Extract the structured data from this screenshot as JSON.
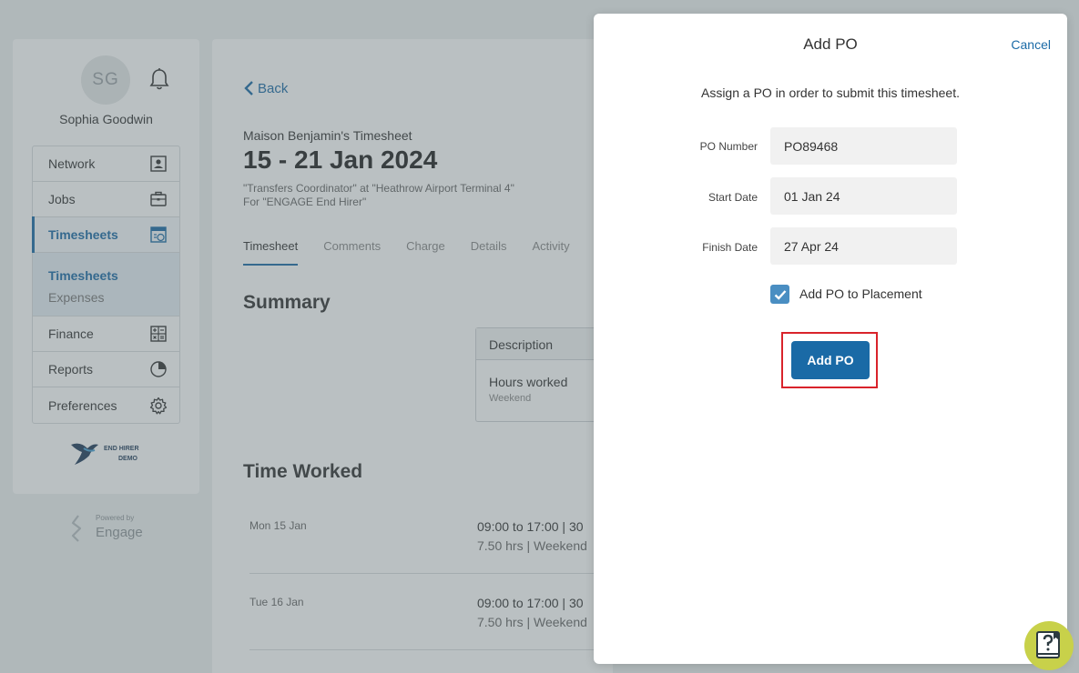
{
  "user": {
    "initials": "SG",
    "name": "Sophia Goodwin"
  },
  "nav": {
    "items": [
      {
        "label": "Network"
      },
      {
        "label": "Jobs"
      },
      {
        "label": "Timesheets"
      },
      {
        "label": "Finance"
      },
      {
        "label": "Reports"
      },
      {
        "label": "Preferences"
      }
    ],
    "sub": [
      {
        "label": "Timesheets"
      },
      {
        "label": "Expenses"
      }
    ]
  },
  "brand": {
    "logo_text_1": "END HIRER",
    "logo_text_2": "DEMO",
    "powered_by": "Powered by",
    "engage": "Engage"
  },
  "page": {
    "back_label": "Back",
    "subtitle": "Maison Benjamin's Timesheet",
    "title": "15 - 21 Jan 2024",
    "meta_line_1": "\"Transfers Coordinator\" at \"Heathrow Airport Terminal 4\"",
    "meta_line_2": "For \"ENGAGE End Hirer\"",
    "tabs": [
      {
        "label": "Timesheet"
      },
      {
        "label": "Comments"
      },
      {
        "label": "Charge"
      },
      {
        "label": "Details"
      },
      {
        "label": "Activity"
      }
    ],
    "summary_heading": "Summary",
    "summary_table": {
      "header": "Description",
      "row_title": "Hours worked",
      "row_sub": "Weekend"
    },
    "time_worked_heading": "Time Worked",
    "time_rows": [
      {
        "date": "Mon 15 Jan",
        "time": "09:00 to 17:00  |  30",
        "hours": "7.50 hrs  |  Weekend"
      },
      {
        "date": "Tue 16 Jan",
        "time": "09:00 to 17:00  |  30",
        "hours": "7.50 hrs  |  Weekend"
      }
    ]
  },
  "modal": {
    "title": "Add PO",
    "cancel_label": "Cancel",
    "instruction": "Assign a PO in order to submit this timesheet.",
    "po_number_label": "PO Number",
    "po_number_value": "PO89468",
    "start_date_label": "Start Date",
    "start_date_value": "01 Jan 24",
    "finish_date_label": "Finish Date",
    "finish_date_value": "27 Apr 24",
    "checkbox_label": "Add PO to Placement",
    "checkbox_checked": true,
    "submit_label": "Add PO"
  },
  "colors": {
    "accent": "#1a6aa6",
    "highlight": "#d9232b",
    "help": "#c8d14a"
  }
}
